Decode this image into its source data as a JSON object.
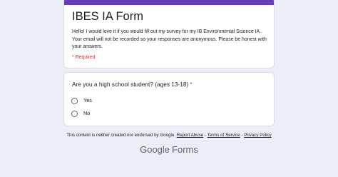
{
  "form": {
    "title": "IBES IA Form",
    "description": "Hello! I would love it if you would fill out my survey for my IB Environmental Science IA. Your email will not be recorded so your responses are anonymous. Please be honest with your answers.",
    "required_note": "* Required",
    "accent_color": "#673ab7"
  },
  "question": {
    "text": "Are you a high school student? (ages 13-18)",
    "required_marker": "*",
    "options": [
      {
        "label": "Yes",
        "selected": false
      },
      {
        "label": "No",
        "selected": false
      }
    ]
  },
  "footer": {
    "notice": "This content is neither created nor endorsed by Google.",
    "links": [
      "Report Abuse",
      "Terms of Service",
      "Privacy Policy"
    ],
    "separator": " - "
  },
  "branding": {
    "word_google": "Google",
    "word_forms": "Forms"
  }
}
